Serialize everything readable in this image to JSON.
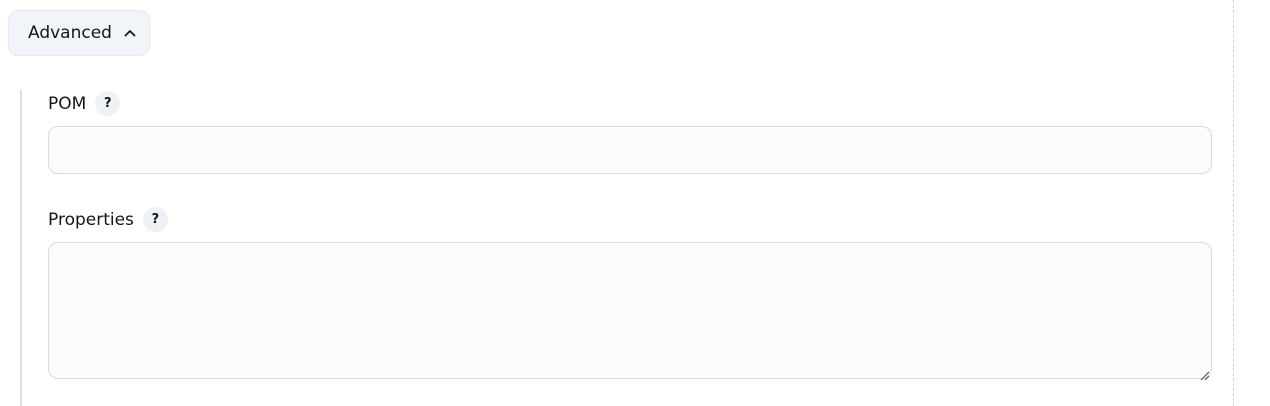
{
  "advanced": {
    "label": "Advanced",
    "expanded_icon": "chevron-up-icon"
  },
  "fields": {
    "pom": {
      "label": "POM",
      "help": "?",
      "value": "",
      "placeholder": ""
    },
    "properties": {
      "label": "Properties",
      "help": "?",
      "value": "",
      "placeholder": ""
    }
  },
  "colors": {
    "button_bg": "#f1f4f8",
    "input_bg": "#fcfcfd",
    "input_border": "#d8dae3",
    "help_bg": "#eef1f6",
    "divider": "#c9d3e6"
  }
}
